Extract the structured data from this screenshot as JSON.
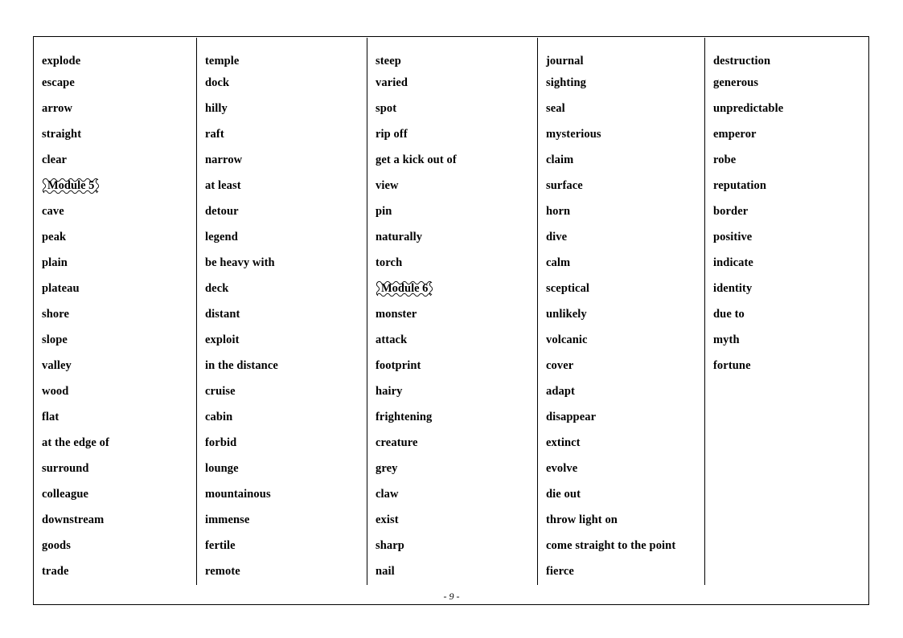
{
  "page": {
    "page_number_label": "- 9 -",
    "border_color": "#000000",
    "background_color": "#ffffff"
  },
  "columns": [
    {
      "name": "column-1",
      "items": [
        {
          "type": "word",
          "text": "explode"
        },
        {
          "type": "word",
          "text": "escape"
        },
        {
          "type": "word",
          "text": "arrow"
        },
        {
          "type": "word",
          "text": "straight"
        },
        {
          "type": "word",
          "text": "clear"
        },
        {
          "type": "module",
          "text": "Module 5"
        },
        {
          "type": "word",
          "text": "cave"
        },
        {
          "type": "word",
          "text": "peak"
        },
        {
          "type": "word",
          "text": "plain"
        },
        {
          "type": "word",
          "text": "plateau"
        },
        {
          "type": "word",
          "text": "shore"
        },
        {
          "type": "word",
          "text": "slope"
        },
        {
          "type": "word",
          "text": "valley"
        },
        {
          "type": "word",
          "text": "wood"
        },
        {
          "type": "word",
          "text": "flat"
        },
        {
          "type": "word",
          "text": "at the edge of"
        },
        {
          "type": "word",
          "text": "surround"
        },
        {
          "type": "word",
          "text": "colleague"
        },
        {
          "type": "word",
          "text": "downstream"
        },
        {
          "type": "word",
          "text": "goods"
        },
        {
          "type": "word",
          "text": "trade"
        }
      ]
    },
    {
      "name": "column-2",
      "items": [
        {
          "type": "word",
          "text": "temple"
        },
        {
          "type": "word",
          "text": "dock"
        },
        {
          "type": "word",
          "text": "hilly"
        },
        {
          "type": "word",
          "text": "raft"
        },
        {
          "type": "word",
          "text": "narrow"
        },
        {
          "type": "word",
          "text": "at least"
        },
        {
          "type": "word",
          "text": "detour"
        },
        {
          "type": "word",
          "text": "legend"
        },
        {
          "type": "word",
          "text": "be heavy with"
        },
        {
          "type": "word",
          "text": "deck"
        },
        {
          "type": "word",
          "text": "distant"
        },
        {
          "type": "word",
          "text": "exploit"
        },
        {
          "type": "word",
          "text": "in the distance"
        },
        {
          "type": "word",
          "text": "cruise"
        },
        {
          "type": "word",
          "text": "cabin"
        },
        {
          "type": "word",
          "text": "forbid"
        },
        {
          "type": "word",
          "text": "lounge"
        },
        {
          "type": "word",
          "text": "mountainous"
        },
        {
          "type": "word",
          "text": "immense"
        },
        {
          "type": "word",
          "text": "fertile"
        },
        {
          "type": "word",
          "text": "remote"
        }
      ]
    },
    {
      "name": "column-3",
      "items": [
        {
          "type": "word",
          "text": "steep"
        },
        {
          "type": "word",
          "text": "varied"
        },
        {
          "type": "word",
          "text": "spot"
        },
        {
          "type": "word",
          "text": "rip off"
        },
        {
          "type": "word",
          "text": "get a kick out of"
        },
        {
          "type": "word",
          "text": "view"
        },
        {
          "type": "word",
          "text": "pin"
        },
        {
          "type": "word",
          "text": "naturally"
        },
        {
          "type": "word",
          "text": "torch"
        },
        {
          "type": "module",
          "text": "Module 6"
        },
        {
          "type": "word",
          "text": "monster"
        },
        {
          "type": "word",
          "text": "attack"
        },
        {
          "type": "word",
          "text": "footprint"
        },
        {
          "type": "word",
          "text": "hairy"
        },
        {
          "type": "word",
          "text": "frightening"
        },
        {
          "type": "word",
          "text": "creature"
        },
        {
          "type": "word",
          "text": "grey"
        },
        {
          "type": "word",
          "text": "claw"
        },
        {
          "type": "word",
          "text": "exist"
        },
        {
          "type": "word",
          "text": "sharp"
        },
        {
          "type": "word",
          "text": "nail"
        }
      ]
    },
    {
      "name": "column-4",
      "items": [
        {
          "type": "word",
          "text": "journal"
        },
        {
          "type": "word",
          "text": "sighting"
        },
        {
          "type": "word",
          "text": "seal"
        },
        {
          "type": "word",
          "text": "mysterious"
        },
        {
          "type": "word",
          "text": "claim"
        },
        {
          "type": "word",
          "text": "surface"
        },
        {
          "type": "word",
          "text": "horn"
        },
        {
          "type": "word",
          "text": "dive"
        },
        {
          "type": "word",
          "text": "calm"
        },
        {
          "type": "word",
          "text": "sceptical"
        },
        {
          "type": "word",
          "text": "unlikely"
        },
        {
          "type": "word",
          "text": "volcanic"
        },
        {
          "type": "word",
          "text": "cover"
        },
        {
          "type": "word",
          "text": "adapt"
        },
        {
          "type": "word",
          "text": "disappear"
        },
        {
          "type": "word",
          "text": "extinct"
        },
        {
          "type": "word",
          "text": "evolve"
        },
        {
          "type": "word",
          "text": "die out"
        },
        {
          "type": "word",
          "text": "throw light on"
        },
        {
          "type": "word",
          "text": "come straight to the point"
        },
        {
          "type": "word",
          "text": "fierce"
        }
      ]
    },
    {
      "name": "column-5",
      "items": [
        {
          "type": "word",
          "text": "destruction"
        },
        {
          "type": "word",
          "text": "generous"
        },
        {
          "type": "word",
          "text": "unpredictable"
        },
        {
          "type": "word",
          "text": "emperor"
        },
        {
          "type": "word",
          "text": "robe"
        },
        {
          "type": "word",
          "text": "reputation"
        },
        {
          "type": "word",
          "text": "border"
        },
        {
          "type": "word",
          "text": "positive"
        },
        {
          "type": "word",
          "text": "indicate"
        },
        {
          "type": "word",
          "text": "identity"
        },
        {
          "type": "word",
          "text": "due to"
        },
        {
          "type": "word",
          "text": "myth"
        },
        {
          "type": "word",
          "text": "fortune"
        }
      ]
    }
  ]
}
